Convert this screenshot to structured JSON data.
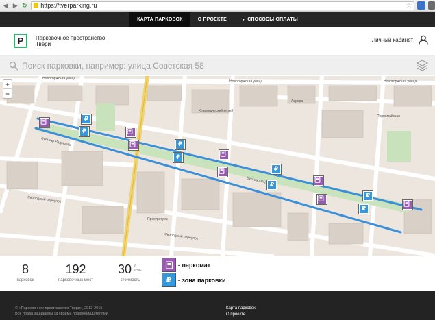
{
  "browser": {
    "url": "https://tverparking.ru"
  },
  "nav": {
    "items": [
      {
        "label": "Карта парковок",
        "active": true
      },
      {
        "label": "О проекте",
        "active": false
      },
      {
        "label": "Способы оплаты",
        "active": false,
        "caret": "▼"
      }
    ]
  },
  "header": {
    "brand_line1": "Парковочное пространство",
    "brand_line2": "Твери",
    "logo_letter": "P",
    "cabinet": "Личный кабинет"
  },
  "search": {
    "placeholder": "Поиск парковки, например: улица Советская 58"
  },
  "map": {
    "zoom_in": "+",
    "zoom_out": "−",
    "street_labels": [
      "Новоторжская улица",
      "Новоторжская улица",
      "Новоторжская улица",
      "Комсомольская улица",
      "Комсомольская улица",
      "Свободный переулок",
      "Свободный переулок",
      "Бульвар Радищева",
      "Бульвар Радищева",
      "Тверской проспект",
      "улица Советская",
      "Прокуратура",
      "Краеведческий музей",
      "Аврора",
      "Первомайская",
      "Театр"
    ],
    "marker_colors": {
      "parkomat": "#9b59b6",
      "zone": "#3498db"
    }
  },
  "stats": {
    "parkings_num": "8",
    "parkings_label": "парковок",
    "places_num": "192",
    "places_label": "парковочных мест",
    "cost_num": "30",
    "cost_unit_top": "₽",
    "cost_unit_bottom": "в час",
    "cost_label": "стоимость"
  },
  "legend": {
    "parkomat_icon": "parking-meter-icon",
    "parkomat_text": "- паркомат",
    "zone_symbol": "₽",
    "zone_text": "- зона парковки"
  },
  "footer": {
    "copyright": "© «Парковочное пространство Твери», 2013-2015",
    "rights": "Все права защищены за своими правообладателями",
    "link1": "Карта парковок",
    "link2": "О проекте"
  }
}
